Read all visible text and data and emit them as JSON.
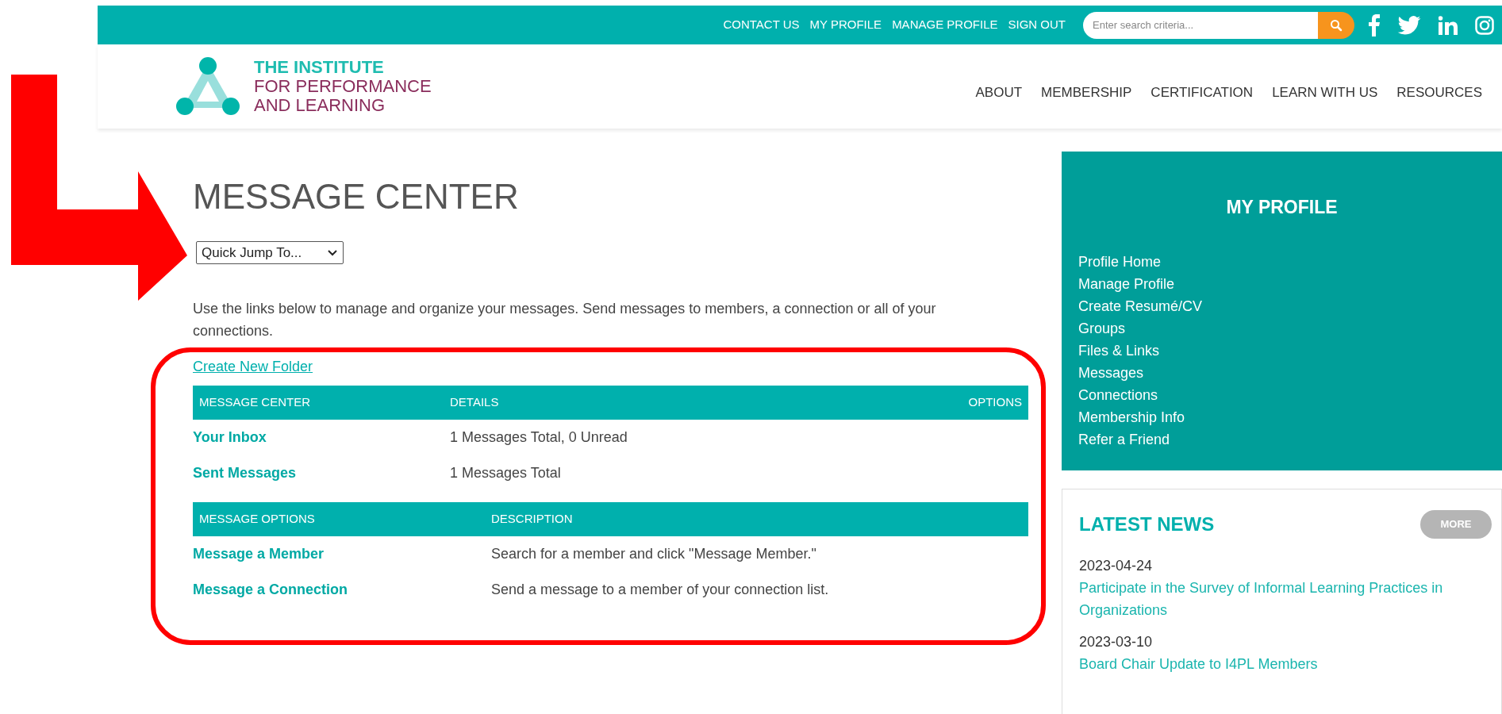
{
  "top_links": [
    "CONTACT US",
    "MY PROFILE",
    "MANAGE PROFILE",
    "SIGN OUT"
  ],
  "search": {
    "placeholder": "Enter search criteria..."
  },
  "logo": {
    "line_1": "THE INSTITUTE",
    "line_2": "FOR PERFORMANCE",
    "line_3": "AND LEARNING"
  },
  "main_nav": [
    "ABOUT",
    "MEMBERSHIP",
    "CERTIFICATION",
    "LEARN WITH US",
    "RESOURCES"
  ],
  "page_title": "MESSAGE CENTER",
  "quick_jump": {
    "value": "Quick Jump To..."
  },
  "intro": "Use the links below to manage and organize your messages. Send messages to members, a connection or all of your connections.",
  "create_folder_link": "Create New Folder",
  "folders_table": {
    "columns": [
      "MESSAGE CENTER",
      "DETAILS",
      "OPTIONS"
    ],
    "rows": [
      {
        "name": "Your Inbox",
        "details": "1 Messages Total, 0 Unread"
      },
      {
        "name": "Sent Messages",
        "details": "1 Messages Total"
      }
    ]
  },
  "options_table": {
    "columns": [
      "MESSAGE OPTIONS",
      "DESCRIPTION"
    ],
    "rows": [
      {
        "name": "Message a Member",
        "description": "Search for a member and click \"Message Member.\""
      },
      {
        "name": "Message a Connection",
        "description": "Send a message to a member of your connection list."
      }
    ]
  },
  "sidebar": {
    "title": "MY PROFILE",
    "items": [
      "Profile Home",
      "Manage Profile",
      "Create Resumé/CV",
      "Groups",
      "Files & Links",
      "Messages",
      "Connections",
      "Membership Info",
      "Refer a Friend"
    ]
  },
  "latest_news": {
    "title": "LATEST NEWS",
    "more_button": "MORE",
    "items": [
      {
        "date": "2023-04-24",
        "title": "Participate in the Survey of Informal Learning Practices in Organizations"
      },
      {
        "date": "2023-03-10",
        "title": "Board Chair Update to I4PL Members"
      }
    ]
  }
}
